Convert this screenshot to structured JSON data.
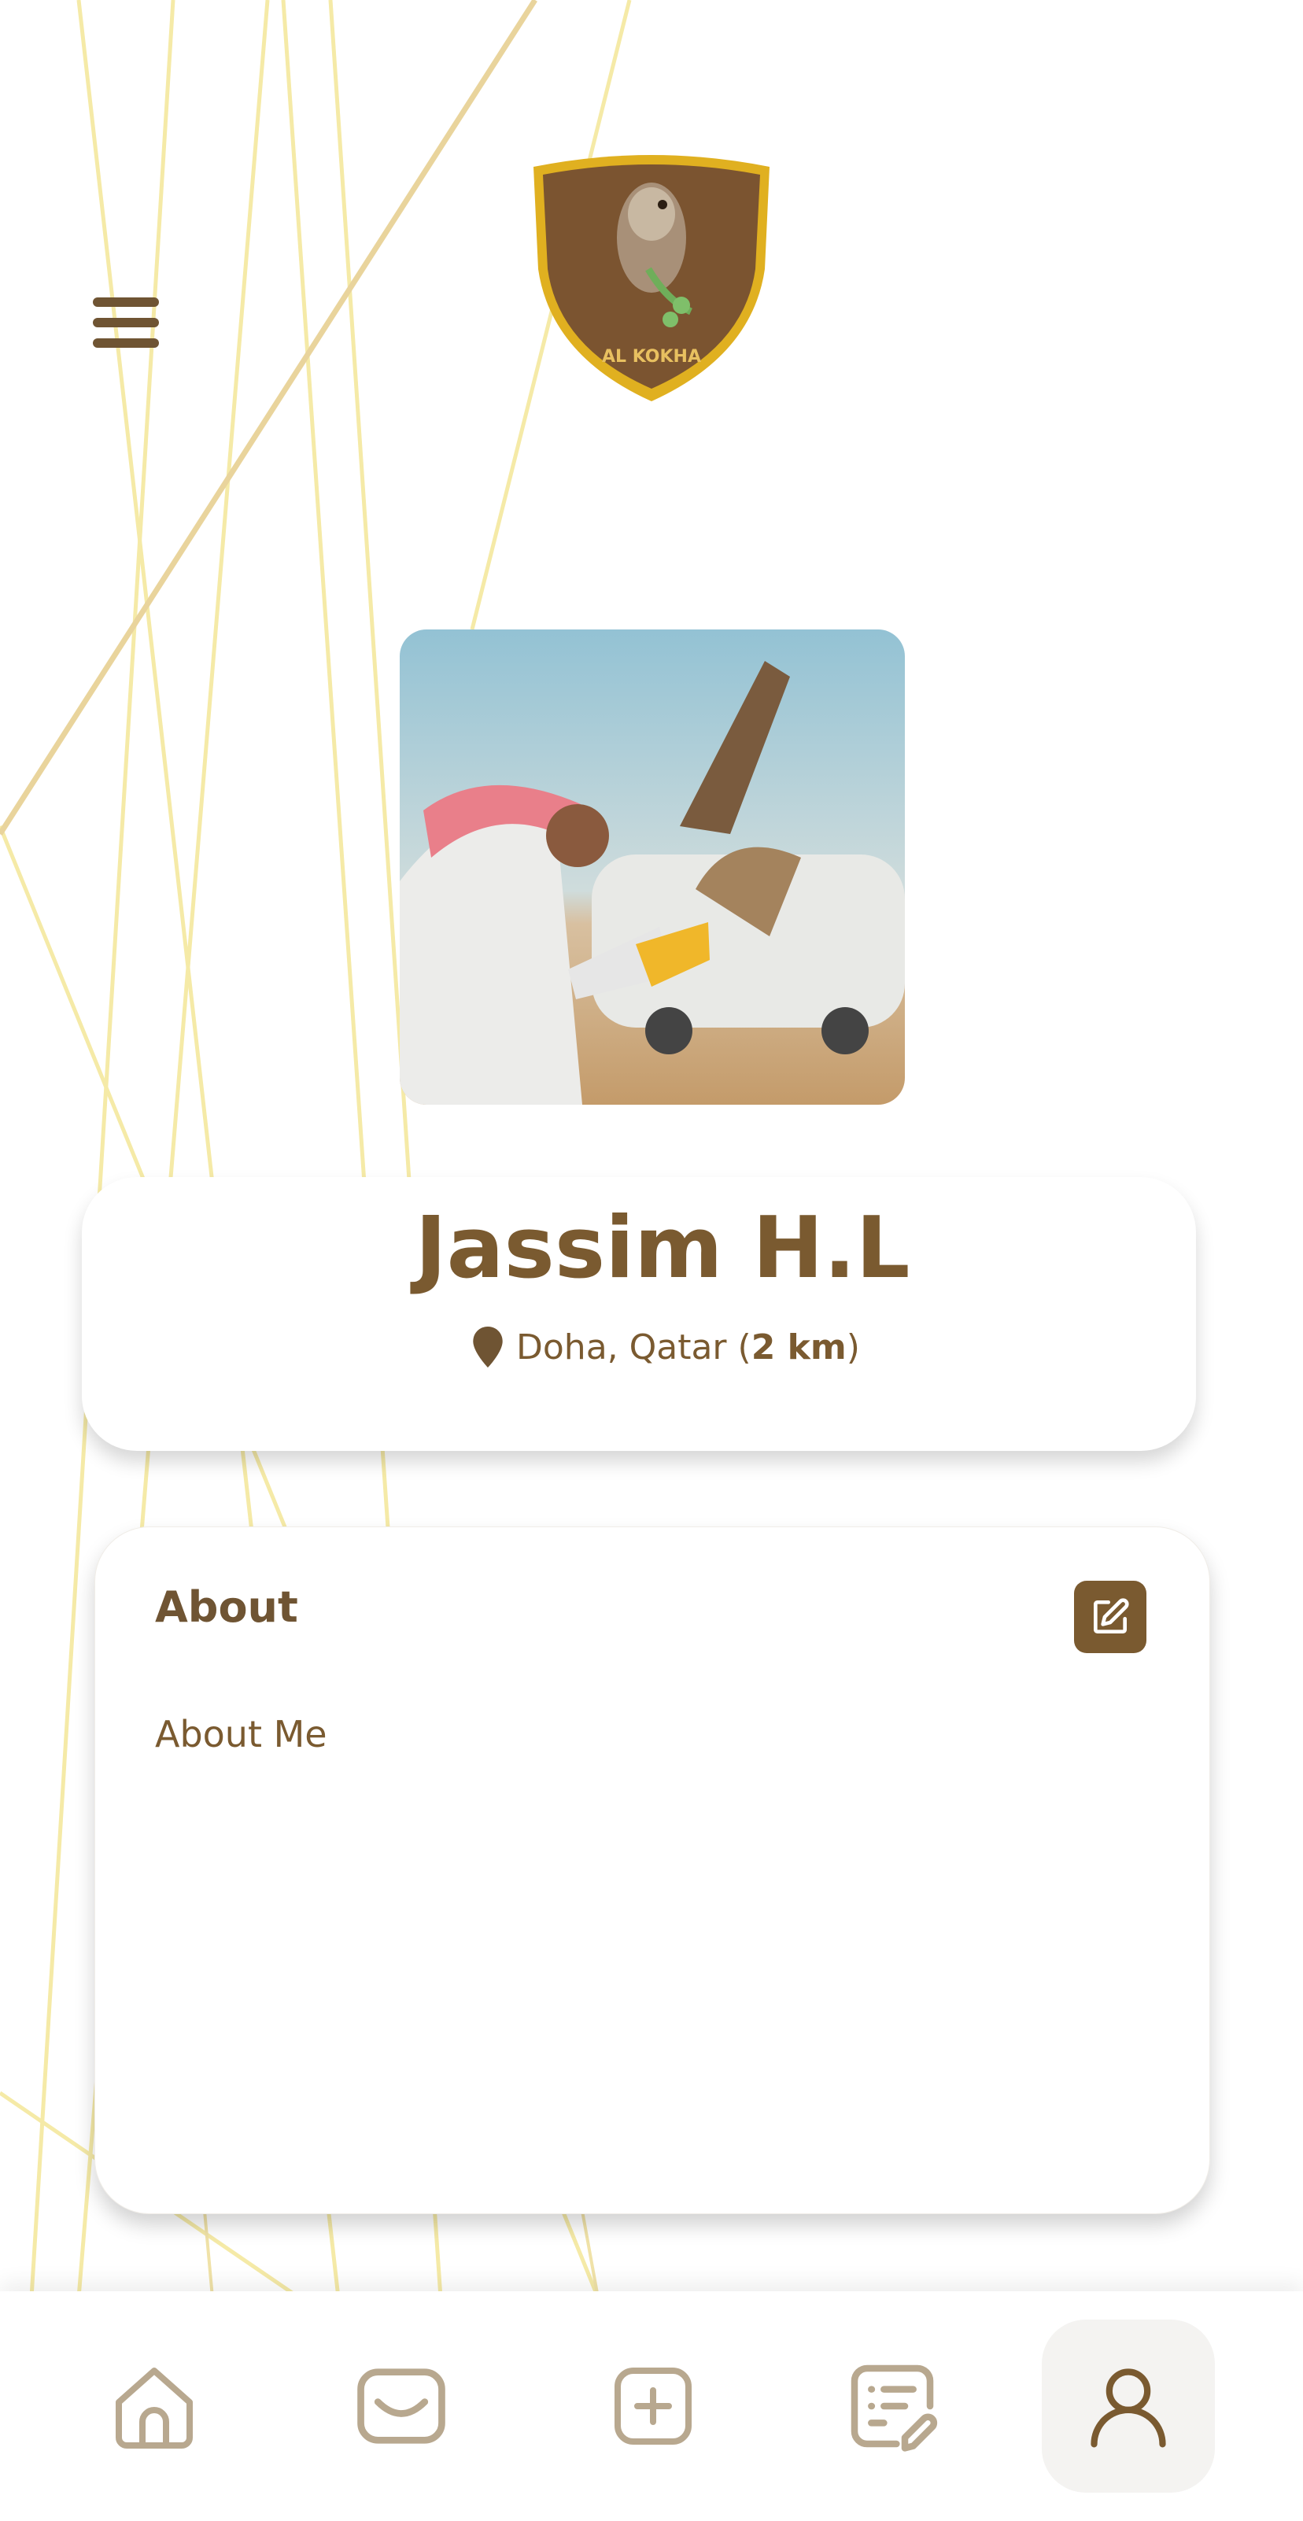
{
  "header": {
    "logo_text": "AL KOKHA"
  },
  "profile": {
    "name": "Jassim H.L",
    "location": "Doha, Qatar",
    "distance": "2 km"
  },
  "about": {
    "title": "About",
    "body": "About Me"
  },
  "icons": {
    "menu": "hamburger-icon",
    "location": "map-pin-icon",
    "edit": "edit-icon",
    "nav": [
      "home-icon",
      "inbox-icon",
      "add-icon",
      "orders-icon",
      "profile-icon"
    ]
  },
  "bottom_nav": {
    "active_index": 4
  },
  "colors": {
    "brand_brown": "#7a5a30",
    "logo_gold": "#e0b020",
    "accent_lines": "#f3e7a0"
  }
}
